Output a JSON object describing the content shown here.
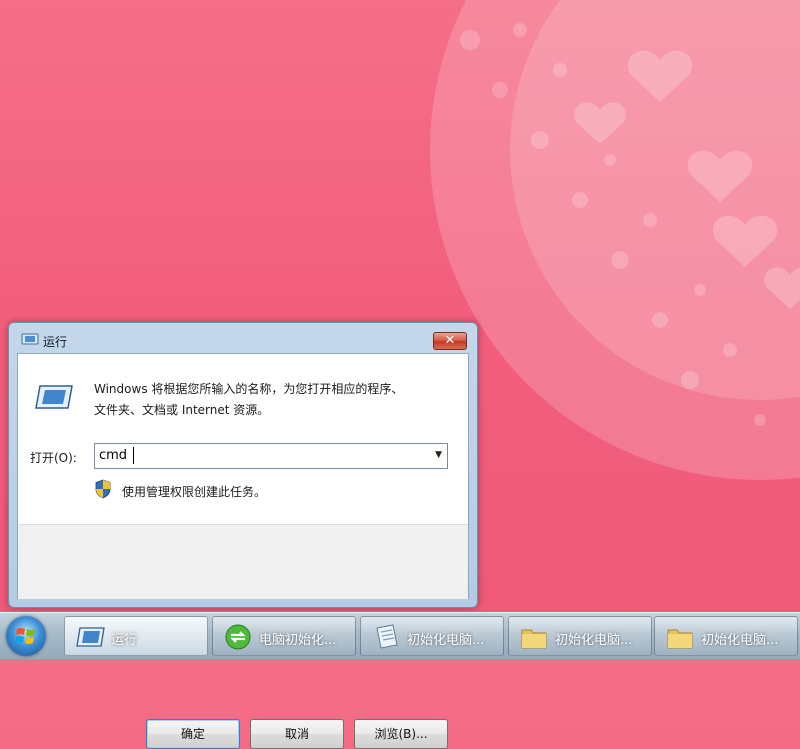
{
  "dialog": {
    "title": "运行",
    "description_line1": "Windows 将根据您所输入的名称，为您打开相应的程序、",
    "description_line2": "文件夹、文档或 Internet 资源。",
    "open_label": "打开(O):",
    "open_value": "cmd",
    "admin_note": "使用管理权限创建此任务。",
    "buttons": {
      "ok": "确定",
      "cancel": "取消",
      "browse": "浏览(B)..."
    }
  },
  "taskbar": {
    "items": [
      {
        "label": "运行",
        "icon": "run-icon"
      },
      {
        "label": "电脑初始化...",
        "icon": "refresh-icon"
      },
      {
        "label": "初始化电脑...",
        "icon": "document-icon"
      },
      {
        "label": "初始化电脑...",
        "icon": "folder-icon"
      },
      {
        "label": "初始化电脑...",
        "icon": "folder-icon"
      }
    ]
  },
  "colors": {
    "wallpaper": "#f25f7d",
    "close_button": "#c13a22",
    "taskbar": "#a9bccb"
  }
}
